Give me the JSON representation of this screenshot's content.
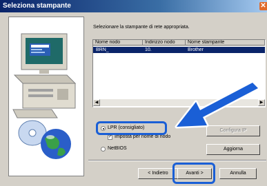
{
  "window": {
    "title": "Seleziona stampante",
    "close_icon": "close-icon"
  },
  "prompt": "Selezionare la stampante di rete appropriata.",
  "list": {
    "columns": [
      "Nome nodo",
      "Indirizzo nodo",
      "Nome stampante"
    ],
    "rows": [
      {
        "node_name": "BRN_",
        "address": "10.",
        "printer": "Brother"
      }
    ]
  },
  "options": {
    "lpr_label": "LPR (consigliato)",
    "lpr_selected": true,
    "setname_label": "Imposta per nome di nodo",
    "setname_checked": true,
    "netbios_label": "NetBIOS",
    "netbios_selected": false
  },
  "buttons": {
    "configure_ip": "Configura IP",
    "refresh": "Aggiorna",
    "back": "< Indietro",
    "next": "Avanti >",
    "cancel": "Annulla"
  },
  "colors": {
    "highlight": "#1a5fd6",
    "selection": "#0a246a",
    "titlebar": "#0a246a"
  }
}
